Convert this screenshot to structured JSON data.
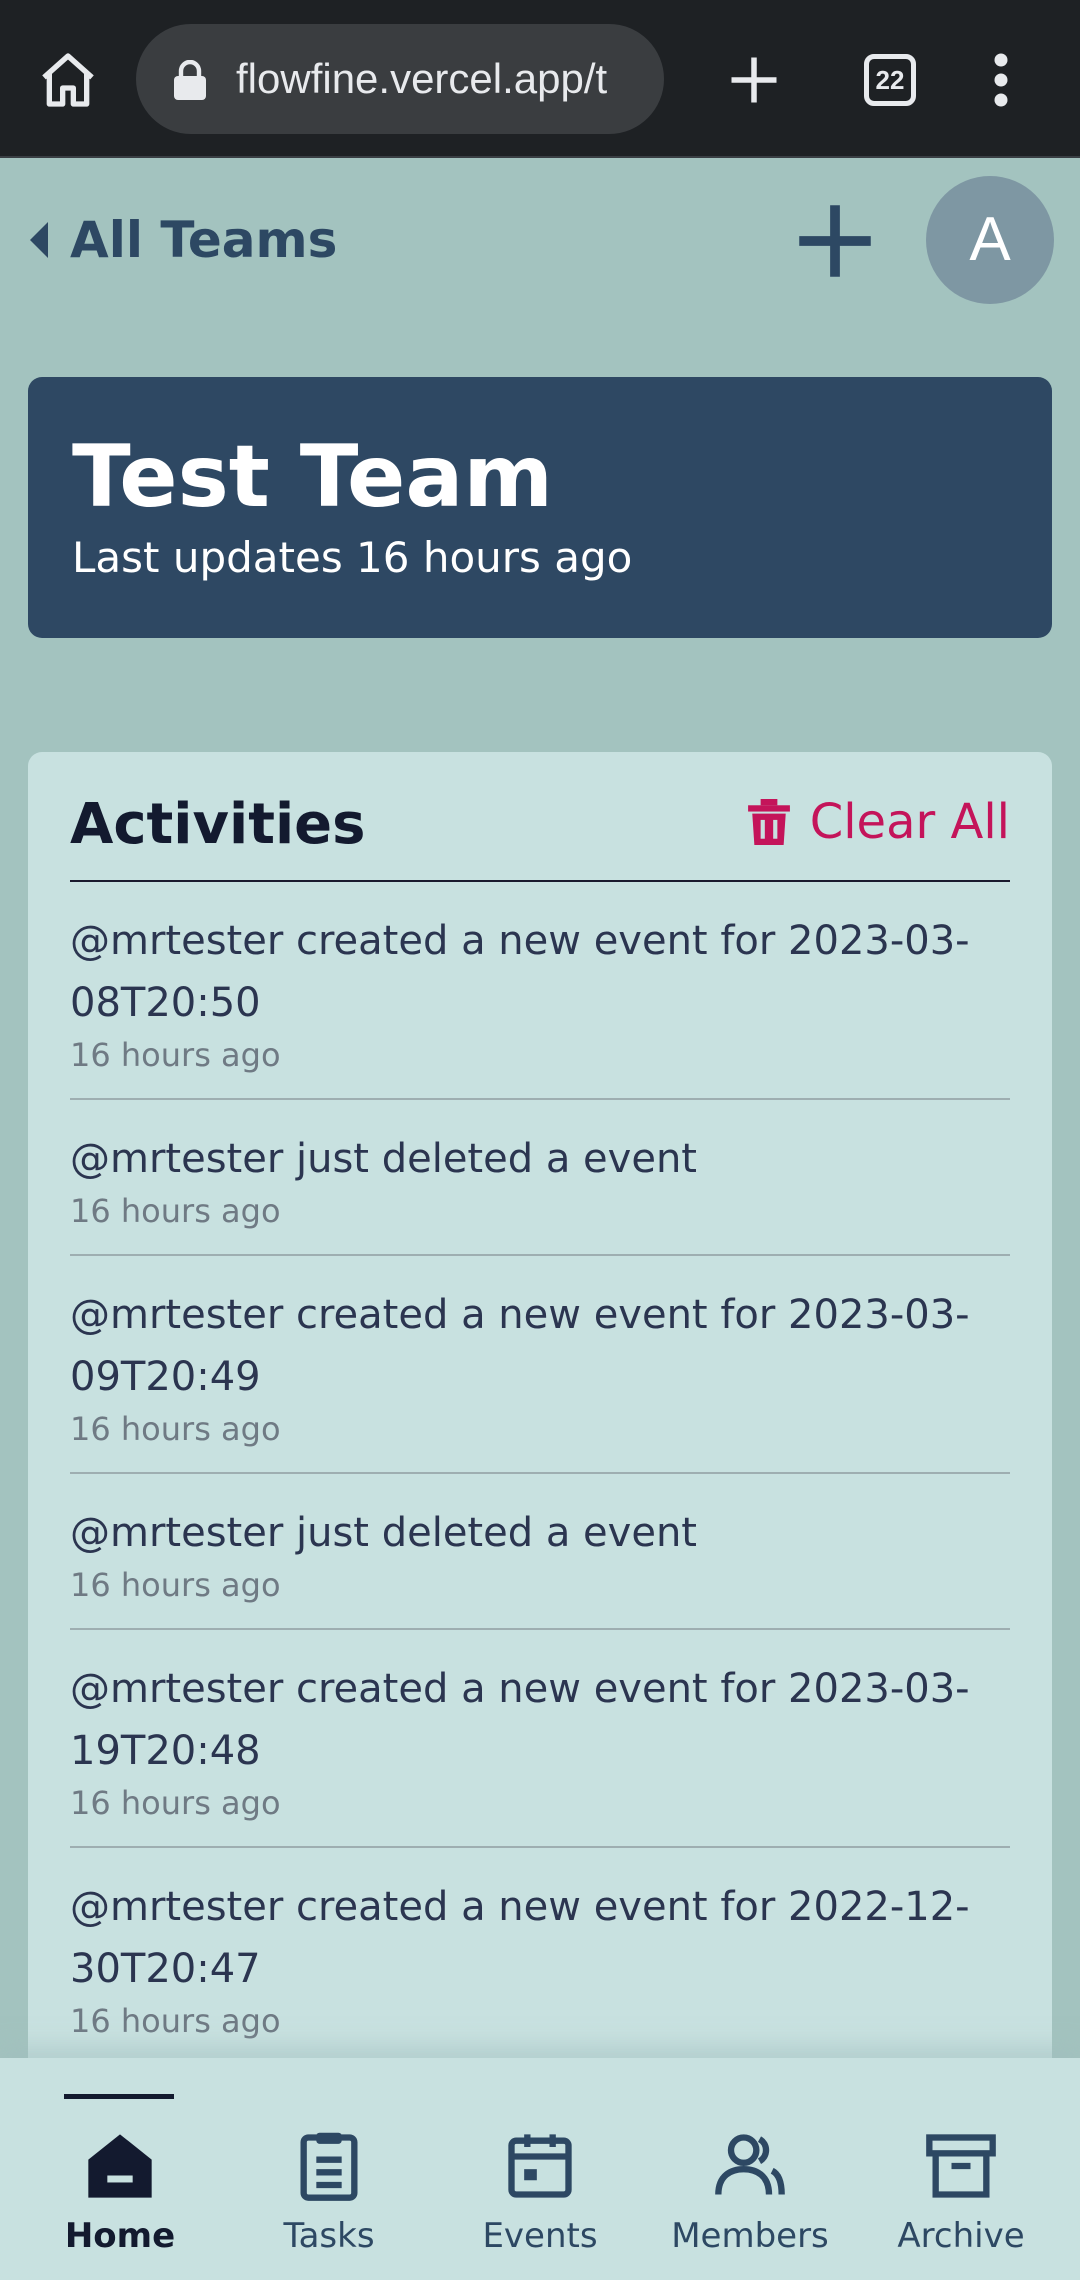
{
  "browser": {
    "url": "flowfine.vercel.app/t",
    "tab_count": "22",
    "icons": [
      "home-icon",
      "lock-icon",
      "plus-icon",
      "tab-switcher-icon",
      "more-vert-icon"
    ]
  },
  "top_nav": {
    "back_label": "All Teams",
    "avatar_letter": "A"
  },
  "team": {
    "name": "Test Team",
    "updated": "Last updates 16 hours ago"
  },
  "activities": {
    "title": "Activities",
    "clear_label": "Clear All",
    "items": [
      {
        "text": "@mrtester created a new event for 2023-03-08T20:50",
        "time": "16 hours ago"
      },
      {
        "text": "@mrtester just deleted a event",
        "time": "16 hours ago"
      },
      {
        "text": "@mrtester created a new event for 2023-03-09T20:49",
        "time": "16 hours ago"
      },
      {
        "text": "@mrtester just deleted a event",
        "time": "16 hours ago"
      },
      {
        "text": "@mrtester created a new event for 2023-03-19T20:48",
        "time": "16 hours ago"
      },
      {
        "text": "@mrtester created a new event for 2022-12-30T20:47",
        "time": "16 hours ago"
      }
    ]
  },
  "bottom_nav": {
    "items": [
      {
        "label": "Home",
        "icon": "home-icon",
        "active": true
      },
      {
        "label": "Tasks",
        "icon": "clipboard-icon",
        "active": false
      },
      {
        "label": "Events",
        "icon": "calendar-icon",
        "active": false
      },
      {
        "label": "Members",
        "icon": "users-icon",
        "active": false
      },
      {
        "label": "Archive",
        "icon": "archive-icon",
        "active": false
      }
    ]
  },
  "colors": {
    "page_bg": "#a3c3bf",
    "card_dark": "#2e4863",
    "card_light": "#c8e1e0",
    "accent_danger": "#c4145a",
    "text_dark": "#131a2f"
  }
}
